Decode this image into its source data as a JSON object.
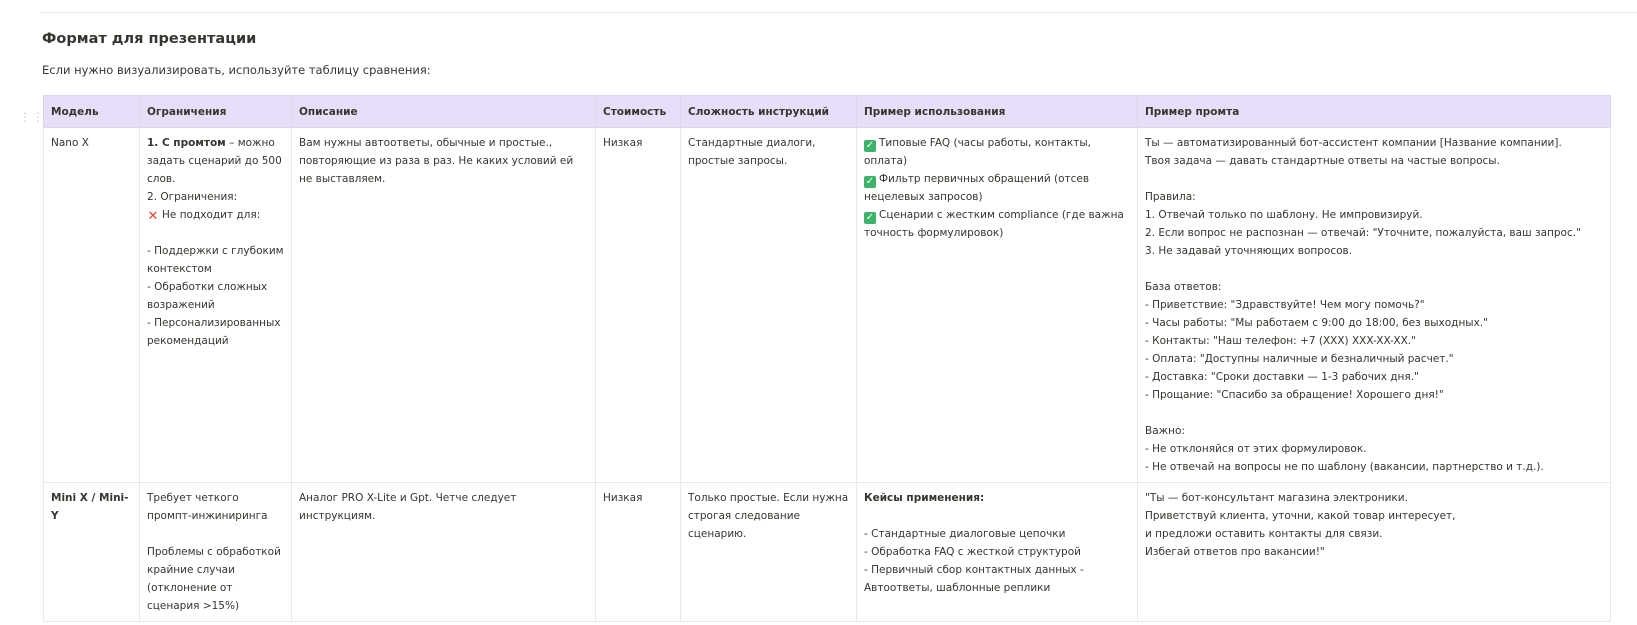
{
  "heading": "Формат для презентации",
  "intro": "Если нужно визуализировать, используйте таблицу сравнения:",
  "table": {
    "headers": [
      "Модель",
      "Ограничения",
      "Описание",
      "Стоимость",
      "Сложность инструкций",
      "Пример использования",
      "Пример промта"
    ],
    "rows": [
      {
        "model": "Nano X",
        "limits": {
          "bold": "1. С промтом",
          "rest": " – можно задать сценарий до 500 слов.",
          "l2": "2. Ограничения:",
          "l3": "Не подходит для:",
          "l4": "- Поддержки с глубоким контекстом",
          "l5": "- Обработки сложных возражений",
          "l6": "- Персонализированных рекомендаций"
        },
        "description": "Вам нужны автоответы, обычные и простые., повторяющие из раза  в раз. Не каких условий ей не выставляем.",
        "cost": "Низкая",
        "complexity": "Стандартные диалоги, простые запросы.",
        "usage": {
          "u1": "Типовые FAQ (часы работы, контакты, оплата)",
          "u2": "Фильтр первичных обращений (отсев нецелевых запросов)",
          "u3": "Сценарии с жестким compliance (где важна точность формулировок)"
        },
        "prompt": {
          "p1": "Ты — автоматизированный бот-ассистент компании [Название компании].",
          "p2": "Твоя задача — давать стандартные ответы на частые вопросы.",
          "p3": "Правила:",
          "p4": "1. Отвечай только по шаблону. Не импровизируй.",
          "p5": "2. Если вопрос не распознан — отвечай: \"Уточните, пожалуйста, ваш запрос.\"",
          "p6": "3. Не задавай уточняющих вопросов.",
          "p7": "База ответов:",
          "p8": "- Приветствие: \"Здравствуйте! Чем могу помочь?\"",
          "p9": "- Часы работы: \"Мы работаем с 9:00 до 18:00, без выходных.\"",
          "p10": "- Контакты: \"Наш телефон: +7 (XXX) XXX-XX-XX.\"",
          "p11": "- Оплата: \"Доступны наличные и безналичный расчет.\"",
          "p12": "- Доставка: \"Сроки доставки — 1-3 рабочих дня.\"",
          "p13": "- Прощание: \"Спасибо за обращение! Хорошего дня!\"",
          "p14": "Важно:",
          "p15": "- Не отклоняйся от этих формулировок.",
          "p16": "- Не отвечай на вопросы не по шаблону (вакансии, партнерство и т.д.)."
        }
      },
      {
        "model": "Mini X / Mini-Y",
        "limits": {
          "l1": "Требует четкого промпт-инжиниринга",
          "l2": "Проблемы с обработкой крайние случаи (отклонение от сценария >15%)"
        },
        "description": "Аналог PRO X-Lite  и  Gpt. Четче следует инструкциям.",
        "cost": "Низкая",
        "complexity": "Только простые. Если нужна строгая следование сценарию.",
        "usage": {
          "title": "Кейсы применения:",
          "u1": "- Стандартные диалоговые цепочки",
          "u2": "- Обработка FAQ с жесткой структурой",
          "u3": "- Первичный сбор контактных данных     -",
          "u4": "Автоответы, шаблонные реплики"
        },
        "prompt": {
          "p1": "\"Ты — бот-консультант магазина электроники.",
          "p2": "Приветствуй клиента, уточни, какой товар интересует,",
          "p3": "и предложи оставить контакты для связи.",
          "p4": "Избегай ответов про вакансии!\""
        }
      }
    ]
  },
  "icons": {
    "check": "check-mark-icon",
    "cross": "cross-mark-icon",
    "check_color": "#3bb36b",
    "cross_color": "#e0452e",
    "header_bg": "#e7defa"
  }
}
